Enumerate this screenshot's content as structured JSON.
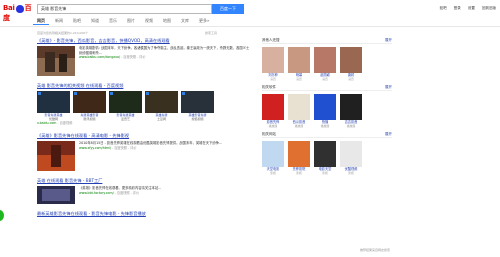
{
  "brand": {
    "logo_text_left": "Bai",
    "logo_text_right": "百度"
  },
  "search": {
    "query": "英雄 影音先锋",
    "button": "百度一下"
  },
  "toplinks": [
    "贴吧",
    "登录",
    "设置",
    "回到旧版"
  ],
  "tabs": [
    "网页",
    "新闻",
    "贴吧",
    "知道",
    "音乐",
    "图片",
    "视频",
    "地图",
    "文库",
    "更多»"
  ],
  "meta": "百度为您找到相关结果约1,210,000个",
  "tools": "搜索工具",
  "results": [
    {
      "title": "《英雄》- 影音先锋，西瓜影音，吉吉影音，快播QVOD，高清在线观看",
      "desc": "电影英雄剧情: 战国末年，天下纷争。各诸侯国为了争夺霸主，战乱迭起，秦王嬴政为一统天下，杀戮无数，各国义士纷纷图谋刺杀...",
      "url": "www.baibu.com/dongzuo/",
      "extra": "- 百度快照 - 评价",
      "colors": [
        "#5b3a2a",
        "#8c6b50",
        "#3a2a1f"
      ]
    },
    {
      "title": "英雄 影音先锋的相关视频 在线观看 - 百度视频",
      "videos": [
        {
          "cap": "影音先锋英雄",
          "sub": "优酷网",
          "color": "#203040"
        },
        {
          "cap": "先锋英雄影音",
          "sub": "腾讯视频",
          "color": "#402818"
        },
        {
          "cap": "影音先锋英雄",
          "sub": "爱奇艺",
          "color": "#1e2a1a"
        },
        {
          "cap": "英雄先锋",
          "sub": "土豆网",
          "color": "#3a3020"
        },
        {
          "cap": "英雄影音先锋",
          "sub": "搜狐视频",
          "color": "#28303a"
        }
      ],
      "url": "v.baidu.com",
      "extra": "- 百度视频"
    },
    {
      "title": "《英雄》影音先锋在线观看 - 高清电影 - 先锋影视",
      "desc": "2010年8月15日 - 影音先锋英雄在线观看由优酷英雄影音先锋提供。战国末年，英雄在天下纷争...",
      "url": "www.xfyy.com/html/",
      "extra": "- 百度快照 - 评价",
      "colors": [
        "#7a2a1a",
        "#c04a20",
        "#4a1a10"
      ]
    },
    {
      "title": "英雄 在线观看 影音先锋 - BBT工厂",
      "desc": "《英雄》影音先锋在线观看。更多精彩内容请关注本站...",
      "url": "www.bbt-factory.com/",
      "extra": "- 百度快照 - 评价",
      "colors": [
        "#2a2a4a",
        "#5a5a8a",
        "#1a1a2a"
      ]
    },
    {
      "title": "最新英雄影音先锋在线观看 - 影音先锋电影 - 先锋影音播放"
    }
  ],
  "side": [
    {
      "head": "其他人还搜",
      "more": "展开",
      "items": [
        {
          "name": "刘亦菲",
          "sub": "演员",
          "color": "#d8b0a0"
        },
        {
          "name": "杨幂",
          "sub": "演员",
          "color": "#c89880"
        },
        {
          "name": "赵丽颖",
          "sub": "演员",
          "color": "#b87868"
        },
        {
          "name": "唐嫣",
          "sub": "演员",
          "color": "#9a6850"
        }
      ]
    },
    {
      "head": "相关软件",
      "more": "展开",
      "items": [
        {
          "name": "影音先锋",
          "sub": "播放器",
          "color": "#d02020"
        },
        {
          "name": "西瓜影音",
          "sub": "播放器",
          "color": "#e8e0d0"
        },
        {
          "name": "快播",
          "sub": "播放器",
          "color": "#2050d0"
        },
        {
          "name": "吉吉影音",
          "sub": "播放器",
          "color": "#202020"
        }
      ]
    },
    {
      "head": "相关网站",
      "more": "展开",
      "items": [
        {
          "name": "天堂电影",
          "sub": "影视",
          "color": "#c0d8f0"
        },
        {
          "name": "先锋影院",
          "sub": "影视",
          "color": "#e07030"
        },
        {
          "name": "电影天堂",
          "sub": "影视",
          "color": "#303030"
        },
        {
          "name": "优酷视频",
          "sub": "影视",
          "color": "#e8e8e8"
        }
      ]
    }
  ],
  "feedback": "推荐结果来自网友搜索"
}
